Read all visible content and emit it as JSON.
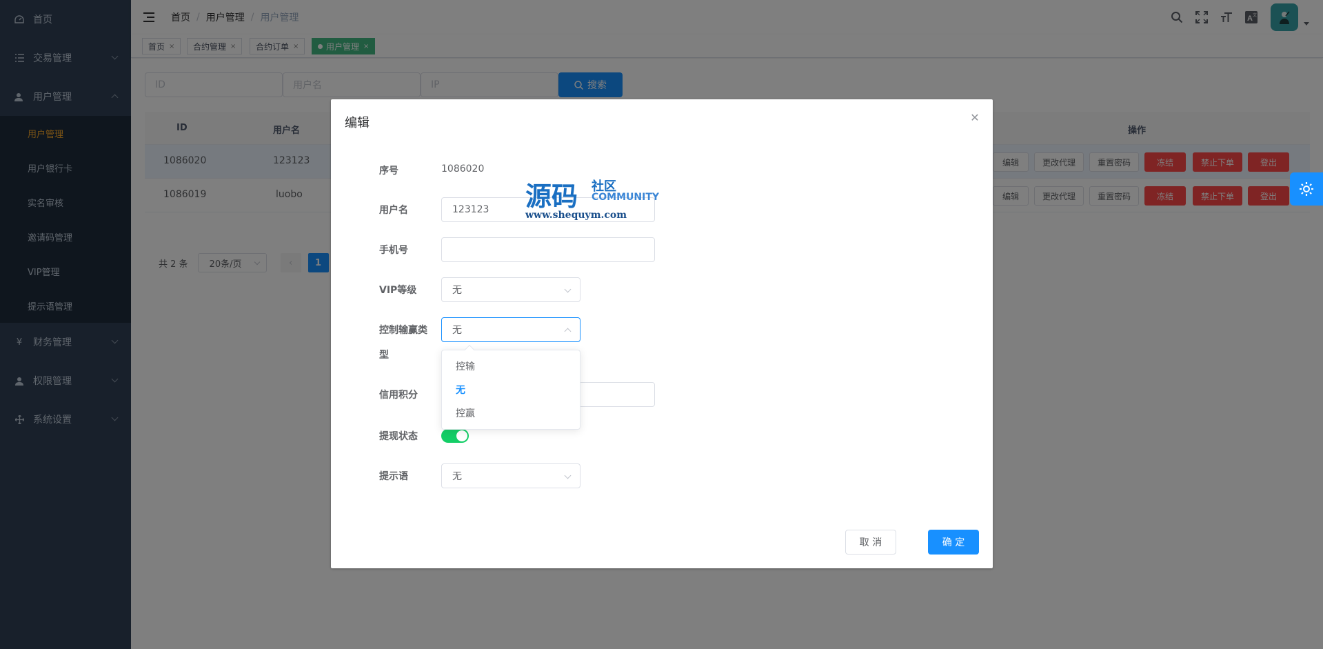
{
  "sidebar": {
    "items": [
      {
        "label": "首页",
        "icon": "dashboard-icon"
      },
      {
        "label": "交易管理",
        "icon": "list-icon"
      },
      {
        "label": "用户管理",
        "icon": "user-icon"
      },
      {
        "label": "财务管理",
        "icon": "yen-icon"
      },
      {
        "label": "权限管理",
        "icon": "user-icon"
      },
      {
        "label": "系统设置",
        "icon": "move-icon"
      }
    ],
    "user_sub": [
      "用户管理",
      "用户银行卡",
      "实名审核",
      "邀请码管理",
      "VIP管理",
      "提示语管理"
    ]
  },
  "header": {
    "breadcrumb": [
      "首页",
      "用户管理",
      "用户管理"
    ]
  },
  "tags": [
    {
      "label": "首页"
    },
    {
      "label": "合约管理"
    },
    {
      "label": "合约订单"
    },
    {
      "label": "用户管理"
    }
  ],
  "filters": {
    "id_placeholder": "ID",
    "username_placeholder": "用户名",
    "ip_placeholder": "IP",
    "search_label": "搜索"
  },
  "table": {
    "headers": {
      "id": "ID",
      "username": "用户名",
      "ops": "操作"
    },
    "rows": [
      {
        "id": "1086020",
        "username": "123123"
      },
      {
        "id": "1086019",
        "username": "luobo"
      }
    ],
    "ops": [
      "编辑",
      "更改代理",
      "重置密码",
      "冻结",
      "禁止下单",
      "登出"
    ]
  },
  "pagination": {
    "total": "共 2 条",
    "page_size": "20条/页",
    "current": "1"
  },
  "dialog": {
    "title": "编辑",
    "labels": {
      "seq": "序号",
      "username": "用户名",
      "phone": "手机号",
      "vip": "VIP等级",
      "control_line1": "控制输赢类",
      "control_line2": "型",
      "credit": "信用积分",
      "withdraw": "提现状态",
      "prompt": "提示语"
    },
    "values": {
      "seq": "1086020",
      "username": "123123",
      "phone": "",
      "vip": "无",
      "control": "无",
      "prompt": "无"
    },
    "control_options": [
      "控输",
      "无",
      "控赢"
    ],
    "withdraw_on": true,
    "cancel": "取 消",
    "confirm": "确 定"
  },
  "watermark": {
    "big": "源码",
    "small": "社区",
    "en": "COMMUNITY",
    "url": "www.shequym.com"
  },
  "colors": {
    "primary": "#1890ff",
    "danger": "#ff4949",
    "success": "#13ce66",
    "sidebar": "#304156",
    "active_menu": "#f4a62a"
  }
}
